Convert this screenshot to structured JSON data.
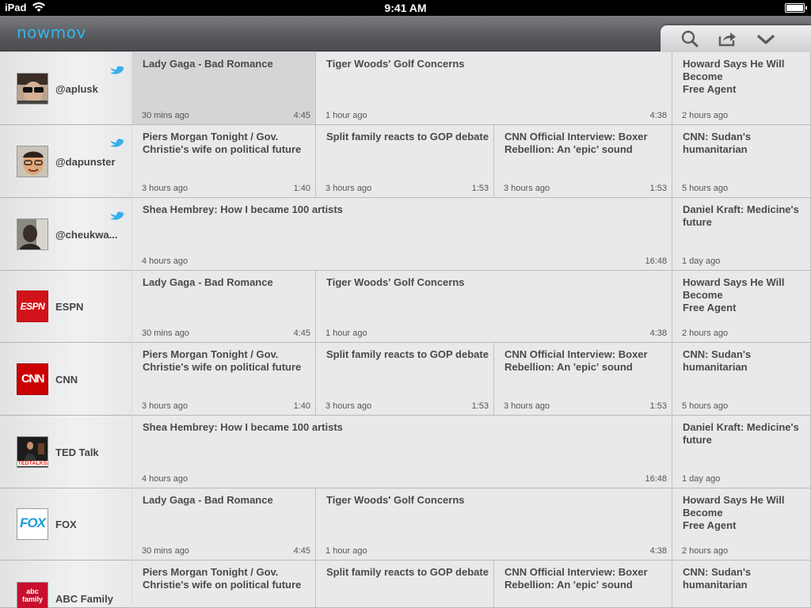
{
  "status": {
    "device": "iPad",
    "time": "9:41 AM"
  },
  "app": {
    "logo": "nowmov"
  },
  "toolbar": {
    "icons": [
      "search-icon",
      "share-icon",
      "chevron-down-icon"
    ]
  },
  "colors": {
    "logo": "#35b7e8",
    "espn": "#d1121a",
    "cnn": "#cc0000",
    "fox": "#1b9ad8",
    "twitter": "#35aeea"
  },
  "channels": [
    {
      "name": "@aplusk",
      "twitter": true
    },
    {
      "name": "@dapunster",
      "twitter": true
    },
    {
      "name": "@cheukwa...",
      "twitter": true
    },
    {
      "name": "ESPN",
      "logo_text": "ESPN"
    },
    {
      "name": "CNN",
      "logo_text": "CNN"
    },
    {
      "name": "TED Talk",
      "logo_text": "TEDTALKS"
    },
    {
      "name": "FOX",
      "logo_text": "FOX"
    },
    {
      "name": "ABC Family",
      "logo_text": "abc family"
    }
  ],
  "rows": [
    {
      "cells": [
        {
          "title": "Lady Gaga - Bad Romance",
          "ago": "30 mins ago",
          "duration": "4:45",
          "selected": true
        },
        {
          "title": "Tiger Woods' Golf Concerns",
          "ago": "1 hour ago",
          "duration": "4:38"
        },
        {
          "title": "Howard Says He Will Become\nFree Agent",
          "ago": "2 hours ago",
          "duration": ""
        }
      ]
    },
    {
      "cells": [
        {
          "title": "Piers Morgan Tonight / Gov.\nChristie's wife on political future",
          "ago": "3 hours ago",
          "duration": "1:40"
        },
        {
          "title": "Split family reacts to GOP debate",
          "ago": "3 hours ago",
          "duration": "1:53"
        },
        {
          "title": "CNN Official Interview: Boxer\nRebellion: An 'epic' sound",
          "ago": "3 hours ago",
          "duration": "1:53"
        },
        {
          "title": "CNN: Sudan's humanitarian",
          "ago": "5 hours ago",
          "duration": ""
        }
      ]
    },
    {
      "cells": [
        {
          "title": "Shea Hembrey: How I became 100 artists",
          "ago": "4 hours ago",
          "duration": "16:48"
        },
        {
          "title": "Daniel Kraft: Medicine's future",
          "ago": "1 day ago",
          "duration": ""
        }
      ]
    },
    {
      "cells": [
        {
          "title": "Lady Gaga - Bad Romance",
          "ago": "30 mins ago",
          "duration": "4:45"
        },
        {
          "title": "Tiger Woods' Golf Concerns",
          "ago": "1 hour ago",
          "duration": "4:38"
        },
        {
          "title": "Howard Says He Will Become\nFree Agent",
          "ago": "2 hours ago",
          "duration": ""
        }
      ]
    },
    {
      "cells": [
        {
          "title": "Piers Morgan Tonight / Gov.\nChristie's wife on political future",
          "ago": "3 hours ago",
          "duration": "1:40"
        },
        {
          "title": "Split family reacts to GOP debate",
          "ago": "3 hours ago",
          "duration": "1:53"
        },
        {
          "title": "CNN Official Interview: Boxer\nRebellion: An 'epic' sound",
          "ago": "3 hours ago",
          "duration": "1:53"
        },
        {
          "title": "CNN: Sudan's humanitarian",
          "ago": "5 hours ago",
          "duration": ""
        }
      ]
    },
    {
      "cells": [
        {
          "title": "Shea Hembrey: How I became 100 artists",
          "ago": "4 hours ago",
          "duration": "16:48"
        },
        {
          "title": "Daniel Kraft: Medicine's future",
          "ago": "1 day ago",
          "duration": ""
        }
      ]
    },
    {
      "cells": [
        {
          "title": "Lady Gaga - Bad Romance",
          "ago": "30 mins ago",
          "duration": "4:45"
        },
        {
          "title": "Tiger Woods' Golf Concerns",
          "ago": "1 hour ago",
          "duration": "4:38"
        },
        {
          "title": "Howard Says He Will Become\nFree Agent",
          "ago": "2 hours ago",
          "duration": ""
        }
      ]
    },
    {
      "cells": [
        {
          "title": "Piers Morgan Tonight / Gov.\nChristie's wife on political future",
          "ago": "",
          "duration": ""
        },
        {
          "title": "Split family reacts to GOP debate",
          "ago": "",
          "duration": ""
        },
        {
          "title": "CNN Official Interview: Boxer\nRebellion: An 'epic' sound",
          "ago": "",
          "duration": ""
        },
        {
          "title": "CNN: Sudan's humanitarian",
          "ago": "",
          "duration": ""
        }
      ]
    }
  ]
}
